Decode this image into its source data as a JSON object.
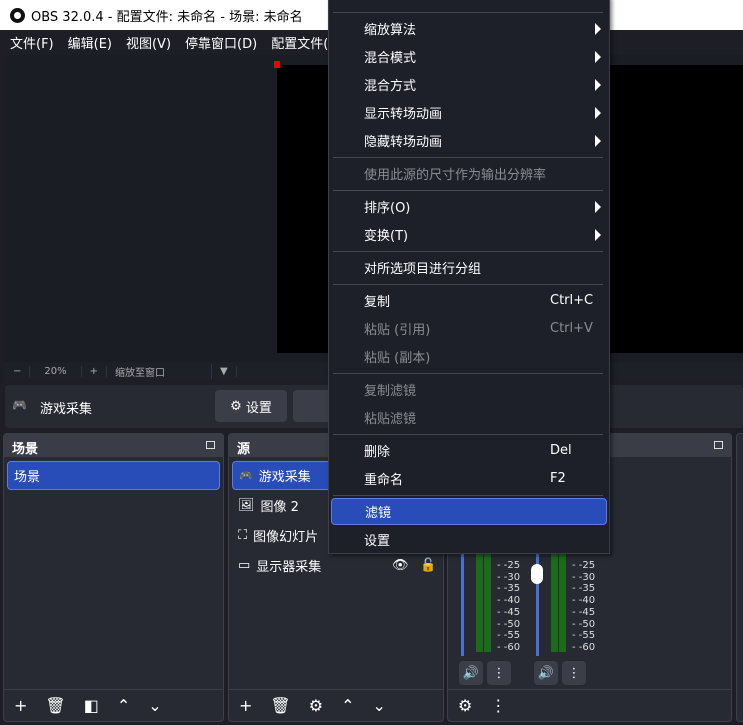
{
  "title": "OBS 32.0.4 - 配置文件: 未命名 - 场景: 未命名",
  "menubar": [
    "文件(F)",
    "编辑(E)",
    "视图(V)",
    "停靠窗口(D)",
    "配置文件(P"
  ],
  "zoombar": {
    "minus": "−",
    "zoom": "20%",
    "plus": "+",
    "fit": "缩放至窗口"
  },
  "source_toolbar": {
    "source_name": "游戏采集",
    "settings": "设置"
  },
  "scenes": {
    "title": "场景",
    "items": [
      "场景"
    ]
  },
  "sources": {
    "title": "源",
    "items": [
      {
        "name": "游戏采集",
        "icon": "gamepad-icon"
      },
      {
        "name": "图像 2",
        "icon": "image-icon"
      },
      {
        "name": "图像幻灯片",
        "icon": "slideshow-icon"
      },
      {
        "name": "显示器采集",
        "icon": "monitor-icon"
      }
    ]
  },
  "mixer": {
    "db_labels": [
      "-25",
      "-30",
      "-35",
      "-40",
      "-45",
      "-50",
      "-55",
      "-60"
    ]
  },
  "context_menu": {
    "submenus": [
      "缩放算法",
      "混合模式",
      "混合方式",
      "显示转场动画",
      "隐藏转场动画"
    ],
    "resize_output": "使用此源的尺寸作为输出分辨率",
    "order": "排序(O)",
    "transform": "变换(T)",
    "group": "对所选项目进行分组",
    "copy": "复制",
    "copy_sc": "Ctrl+C",
    "paste_ref": "粘贴 (引用)",
    "paste_ref_sc": "Ctrl+V",
    "paste_dup": "粘贴 (副本)",
    "copy_filters": "复制滤镜",
    "paste_filters": "粘贴滤镜",
    "delete": "删除",
    "delete_sc": "Del",
    "rename": "重命名",
    "rename_sc": "F2",
    "filters": "滤镜",
    "properties": "设置"
  },
  "colors": {
    "accent": "#284cb8",
    "meter": "#1a6b1a",
    "bg": "#1e1f26"
  }
}
